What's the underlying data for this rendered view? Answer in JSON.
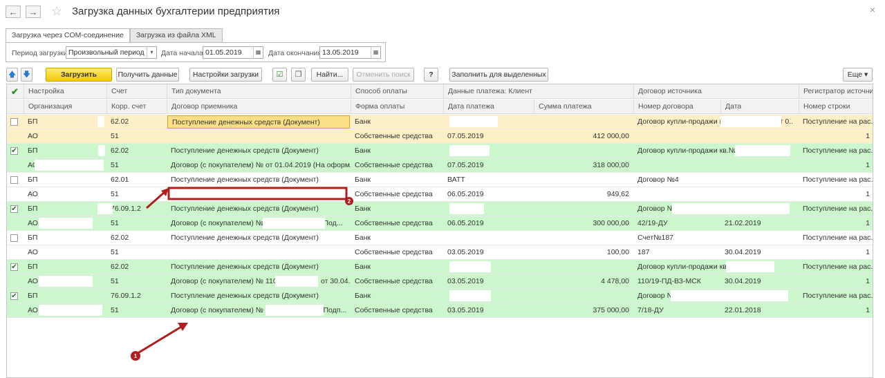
{
  "window": {
    "title": "Загрузка данных бухгалтерии предприятия"
  },
  "tabs": [
    {
      "label": "Загрузка через COM-соединение",
      "active": true
    },
    {
      "label": "Загрузка из файла XML",
      "active": false
    }
  ],
  "period": {
    "period_label": "Период загрузки:",
    "period_value": "Произвольный период",
    "start_label": "Дата начала:",
    "start_value": "01.05.2019",
    "end_label": "Дата окончания:",
    "end_value": "13.05.2019"
  },
  "toolbar": {
    "load": "Загрузить данные",
    "get": "Получить данные",
    "settings": "Настройки загрузки",
    "find": "Найти...",
    "cancel_search": "Отменить поиск",
    "help": "?",
    "fill_selected": "Заполнить для выделенных",
    "more": "Еще"
  },
  "headers": {
    "top": [
      "Настройка",
      "Счет",
      "Тип документа",
      "Способ оплаты",
      "Данные платежа: Клиент",
      "Договор источника",
      "Регистратор источни..."
    ],
    "bottom": [
      "Организация",
      "Корр. счет",
      "Договор приемника",
      "Форма оплаты",
      "Дата платежа",
      "Сумма платежа",
      "Номер договора",
      "Дата",
      "Номер строки"
    ]
  },
  "records": [
    {
      "checked": false,
      "top": {
        "org": "БП",
        "acc": "62.02",
        "doc": "Поступление денежных средств (Документ)",
        "pay": "Банк",
        "client": "",
        "contract": "Договор купли-продажи кв.(N",
        "cdate": "от 0..",
        "reg": "Поступление на рас..."
      },
      "bottom": {
        "org": "АО",
        "acc": "51",
        "doc": "",
        "form": "Собственные средства",
        "date": "07.05.2019",
        "sum": "412 000,00",
        "num": "",
        "ndate": "",
        "line": "1"
      }
    },
    {
      "checked": true,
      "top": {
        "org": "БП",
        "acc": "62.02",
        "doc": "Поступление денежных средств (Документ)",
        "pay": "Банк",
        "client": "",
        "contract": "Договор купли-продажи кв.№ (№",
        "cdate": "",
        "reg": "Поступление на рас..."
      },
      "bottom": {
        "org": "АО",
        "acc": "51",
        "doc": "Договор (с покупателем) №  от 01.04.2019 (На оформлен...",
        "form": "Собственные средства",
        "date": "07.05.2019",
        "sum": "318 000,00",
        "num": "",
        "ndate": "",
        "line": "1"
      }
    },
    {
      "checked": false,
      "top": {
        "org": "БП",
        "acc": "62.01",
        "doc": "Поступление денежных средств (Документ)",
        "pay": "Банк",
        "client": "ВАТТ",
        "contract": "Договор №4",
        "cdate": "",
        "reg": "Поступление на рас..."
      },
      "bottom": {
        "org": "АО",
        "acc": "51",
        "doc": "",
        "form": "Собственные средства",
        "date": "06.05.2019",
        "sum": "949,62",
        "num": "",
        "ndate": "",
        "line": "1"
      }
    },
    {
      "checked": true,
      "top": {
        "org": "БП",
        "acc": "76.09.1.2",
        "doc": "Поступление денежных средств (Документ)",
        "pay": "Банк",
        "client": "",
        "contract": "Договор №",
        "cdate": "",
        "reg": "Поступление на рас..."
      },
      "bottom": {
        "org": "АО",
        "acc": "51",
        "doc": "Договор (с покупателем) № 4",
        "docTail": "(Под...",
        "form": "Собственные средства",
        "date": "06.05.2019",
        "sum": "300 000,00",
        "num": "42/19-ДУ",
        "ndate": "21.02.2019",
        "line": "1"
      }
    },
    {
      "checked": false,
      "top": {
        "org": "БП",
        "acc": "62.02",
        "doc": "Поступление денежных средств (Документ)",
        "pay": "Банк",
        "client": "",
        "contract": "Счет№187",
        "cdate": "",
        "reg": "Поступление на рас..."
      },
      "bottom": {
        "org": "АО",
        "acc": "51",
        "doc": "",
        "form": "Собственные средства",
        "date": "03.05.2019",
        "sum": "100,00",
        "num": "187",
        "ndate": "30.04.2019",
        "line": "1"
      }
    },
    {
      "checked": true,
      "top": {
        "org": "БП",
        "acc": "62.02",
        "doc": "Поступление денежных средств (Документ)",
        "pay": "Банк",
        "client": "",
        "contract": "Договор купли-продажи кв.№",
        "cdate": "",
        "reg": "Поступление на рас..."
      },
      "bottom": {
        "org": "АО",
        "acc": "51",
        "doc": "Договор (с покупателем) № 110",
        "docTail": "от 30.04....",
        "form": "Собственные средства",
        "date": "03.05.2019",
        "sum": "4 478,00",
        "num": "110/19-ПД-ВЗ-МСК",
        "ndate": "30.04.2019",
        "line": "1"
      }
    },
    {
      "checked": true,
      "top": {
        "org": "БП",
        "acc": "76.09.1.2",
        "doc": "Поступление денежных средств (Документ)",
        "pay": "Банк",
        "client": "",
        "contract": "Договор №",
        "cdate": "",
        "reg": "Поступление на рас..."
      },
      "bottom": {
        "org": "АО",
        "acc": "51",
        "doc": "Договор (с покупателем) № 7",
        "docTail": "(Подп...",
        "form": "Собственные средства",
        "date": "03.05.2019",
        "sum": "375 000,00",
        "num": "7/18-ДУ",
        "ndate": "22.01.2018",
        "line": "1"
      }
    }
  ],
  "annotations": [
    {
      "number": "1",
      "color": "#b01e1e"
    },
    {
      "number": "2",
      "color": "#b01e1e"
    }
  ]
}
